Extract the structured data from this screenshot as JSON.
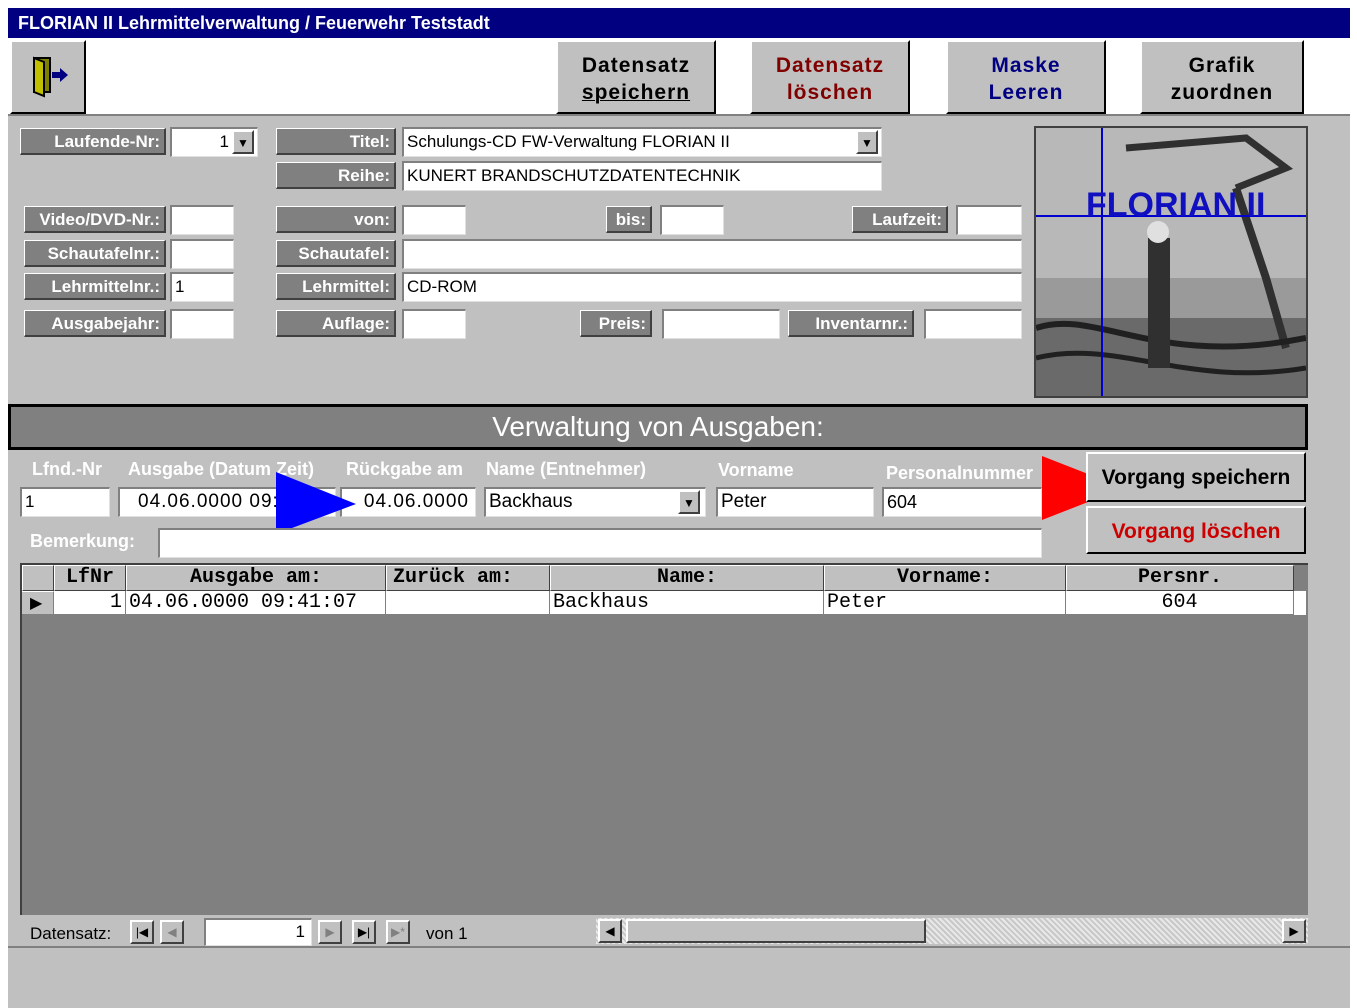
{
  "window": {
    "title": "FLORIAN II Lehrmittelverwaltung / Feuerwehr Teststadt"
  },
  "toolbar": {
    "exit_icon": "exit-door-icon",
    "save_record": [
      "Datensatz",
      "speichern"
    ],
    "delete_record": [
      "Datensatz",
      "löschen"
    ],
    "clear_form": [
      "Maske",
      "Leeren"
    ],
    "assign_graphic": [
      "Grafik",
      "zuordnen"
    ],
    "delete_color": "#800000",
    "clear_color": "#000080"
  },
  "form": {
    "laufende_nr": {
      "label": "Laufende-Nr:",
      "value": "1"
    },
    "titel": {
      "label": "Titel:",
      "value": "Schulungs-CD FW-Verwaltung FLORIAN II"
    },
    "reihe": {
      "label": "Reihe:",
      "value": "KUNERT BRANDSCHUTZDATENTECHNIK"
    },
    "video_nr": {
      "label": "Video/DVD-Nr.:",
      "value": ""
    },
    "von": {
      "label": "von:",
      "value": ""
    },
    "bis": {
      "label": "bis:",
      "value": ""
    },
    "laufzeit": {
      "label": "Laufzeit:",
      "value": ""
    },
    "schautafelnr": {
      "label": "Schautafelnr.:",
      "value": ""
    },
    "schautafel": {
      "label": "Schautafel:",
      "value": ""
    },
    "lehrmittelnr": {
      "label": "Lehrmittelnr.:",
      "value": "1"
    },
    "lehrmittel": {
      "label": "Lehrmittel:",
      "value": "CD-ROM"
    },
    "ausgabejahr": {
      "label": "Ausgabejahr:",
      "value": ""
    },
    "auflage": {
      "label": "Auflage:",
      "value": ""
    },
    "preis": {
      "label": "Preis:",
      "value": ""
    },
    "inventarnr": {
      "label": "Inventarnr.:",
      "value": ""
    }
  },
  "image_panel": {
    "caption": "FLORIAN II"
  },
  "issues": {
    "section_title": "Verwaltung von Ausgaben:",
    "headers": {
      "lfnd": "Lfnd.-Nr",
      "ausgabe": "Ausgabe (Datum Zeit)",
      "rueckgabe": "Rückgabe am",
      "name": "Name (Entnehmer)",
      "vorname": "Vorname",
      "personalnummer": "Personalnummer"
    },
    "values": {
      "lfnd": "1",
      "ausgabe": "04.06.0000 09:41:07",
      "rueckgabe": "04.06.0000",
      "name": "Backhaus",
      "vorname": "Peter",
      "personalnummer": "604"
    },
    "bemerkung_label": "Bemerkung:",
    "bemerkung_value": "",
    "save_button": "Vorgang speichern",
    "delete_button": "Vorgang löschen",
    "delete_color": "#cc0000",
    "arrow_blue": "#0000ff",
    "arrow_red": "#ff0000"
  },
  "grid": {
    "columns": [
      "LfNr",
      "Ausgabe am:",
      "Zurück am:",
      "Name:",
      "Vorname:",
      "Persnr."
    ],
    "rows": [
      {
        "lfnr": "1",
        "ausgabe": "04.06.0000 09:41:07",
        "zurueck": "",
        "name": "Backhaus",
        "vorname": "Peter",
        "persnr": "604"
      }
    ]
  },
  "navigator": {
    "label": "Datensatz:",
    "current": "1",
    "of_text": "von 1"
  }
}
